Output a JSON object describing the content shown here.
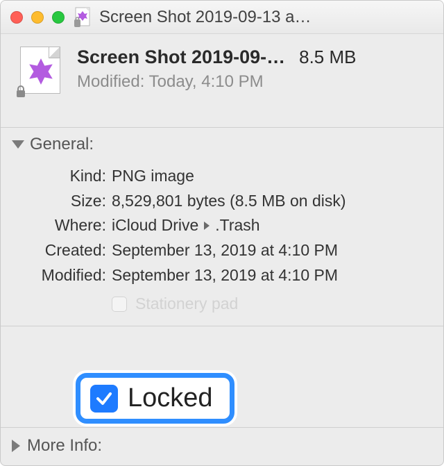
{
  "window": {
    "title": "Screen Shot 2019-09-13 a…"
  },
  "header": {
    "filename": "Screen Shot 2019-09-…",
    "filesize": "8.5 MB",
    "modified_label": "Modified:",
    "modified_value": "Today, 4:10 PM"
  },
  "sections": {
    "general": {
      "title": "General:",
      "rows": {
        "kind": {
          "label": "Kind:",
          "value": "PNG image"
        },
        "size": {
          "label": "Size:",
          "value": "8,529,801 bytes (8.5 MB on disk)"
        },
        "where": {
          "label": "Where:",
          "value_part1": "iCloud Drive",
          "value_part2": ".Trash"
        },
        "created": {
          "label": "Created:",
          "value": "September 13, 2019 at 4:10 PM"
        },
        "modified": {
          "label": "Modified:",
          "value": "September 13, 2019 at 4:10 PM"
        }
      },
      "stationery": {
        "label": "Stationery pad",
        "checked": false
      },
      "locked": {
        "label": "Locked",
        "checked": true
      }
    },
    "more_info": {
      "title": "More Info:"
    }
  }
}
